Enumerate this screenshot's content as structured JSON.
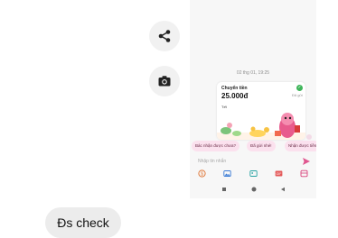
{
  "actions": {
    "share_icon": "share-icon",
    "camera_icon": "camera-icon"
  },
  "message": {
    "text": "Đs check"
  },
  "chat": {
    "timestamp": "02 thg 01, 19:25",
    "card": {
      "title": "Chuyển tiền",
      "status": "Đã gửi",
      "amount": "25.000đ",
      "note": "Tết"
    },
    "suggestions": [
      "Bác nhận được chưa?",
      "Đã gửi nhé!",
      "Nhận được tiền"
    ],
    "input_placeholder": "Nhập tin nhắn",
    "toolbar_icons": [
      "money-icon",
      "image-icon",
      "gallery-icon",
      "gif-icon",
      "sticker-icon"
    ],
    "nav_icons": [
      "nav-square-icon",
      "nav-circle-icon",
      "nav-back-icon"
    ],
    "accent": "#e0568f",
    "chip_bg": "#fbe1ee"
  }
}
